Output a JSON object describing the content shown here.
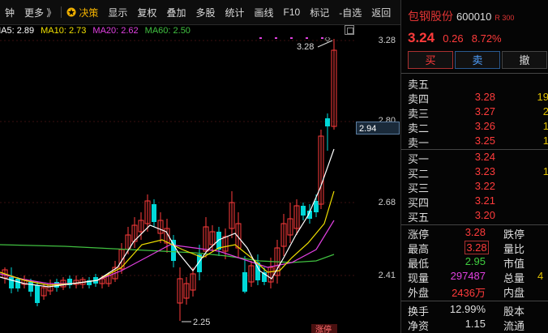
{
  "toolbar": {
    "items": [
      "钟",
      "更多",
      "决策",
      "显示",
      "复权",
      "叠加",
      "多股",
      "统计",
      "画线",
      "F10",
      "标记",
      "-自选",
      "返回"
    ],
    "more_suffix": "》"
  },
  "ma_legend": {
    "ma5": "MA5: 2.89",
    "ma10": "MA10: 2.73",
    "ma20": "MA20: 2.62",
    "ma60": "MA60: 2.50",
    "colors": {
      "ma5": "#ffffff",
      "ma10": "#f0e000",
      "ma20": "#e040e0",
      "ma60": "#40c040"
    }
  },
  "price_axis": {
    "labels": [
      "3.28",
      "2.80",
      "2.68",
      "2.41"
    ],
    "current": "2.94"
  },
  "annotations": {
    "high": "3.28",
    "low": "2.25",
    "limit_up": "涨停"
  },
  "stock": {
    "name": "包钢股份",
    "code": "600010",
    "badge": "R 300",
    "price": "3.24",
    "change": "0.26",
    "change_pct": "8.72%"
  },
  "buttons": {
    "buy": "买",
    "sell": "卖",
    "cancel": "撤"
  },
  "order_book": {
    "asks": [
      {
        "label": "卖五",
        "price": "",
        "vol": ""
      },
      {
        "label": "卖四",
        "price": "3.28",
        "vol": "19"
      },
      {
        "label": "卖三",
        "price": "3.27",
        "vol": "2"
      },
      {
        "label": "卖二",
        "price": "3.26",
        "vol": "1"
      },
      {
        "label": "卖一",
        "price": "3.25",
        "vol": "1"
      }
    ],
    "bids": [
      {
        "label": "买一",
        "price": "3.24",
        "vol": ""
      },
      {
        "label": "买二",
        "price": "3.23",
        "vol": "1"
      },
      {
        "label": "买三",
        "price": "3.22",
        "vol": ""
      },
      {
        "label": "买四",
        "price": "3.21",
        "vol": ""
      },
      {
        "label": "买五",
        "price": "3.20",
        "vol": ""
      }
    ]
  },
  "stats": [
    {
      "l1": "涨停",
      "v1": "3.28",
      "c1": "#ff3b3b",
      "l2": "跌停",
      "v2": ""
    },
    {
      "l1": "最高",
      "v1": "3.28",
      "c1": "#ff3b3b",
      "l2": "量比",
      "v2": "",
      "box": true
    },
    {
      "l1": "最低",
      "v1": "2.95",
      "c1": "#40d040",
      "l2": "市值",
      "v2": ""
    },
    {
      "l1": "现量",
      "v1": "297487",
      "c1": "#e040e0",
      "l2": "总量",
      "v2": "4"
    },
    {
      "l1": "外盘",
      "v1": "2436万",
      "c1": "#ff3b3b",
      "l2": "内盘",
      "v2": ""
    },
    {
      "l1": "换手",
      "v1": "12.99%",
      "c1": "#dddddd",
      "l2": "股本",
      "v2": ""
    },
    {
      "l1": "净资",
      "v1": "1.15",
      "c1": "#dddddd",
      "l2": "流通",
      "v2": ""
    }
  ]
}
